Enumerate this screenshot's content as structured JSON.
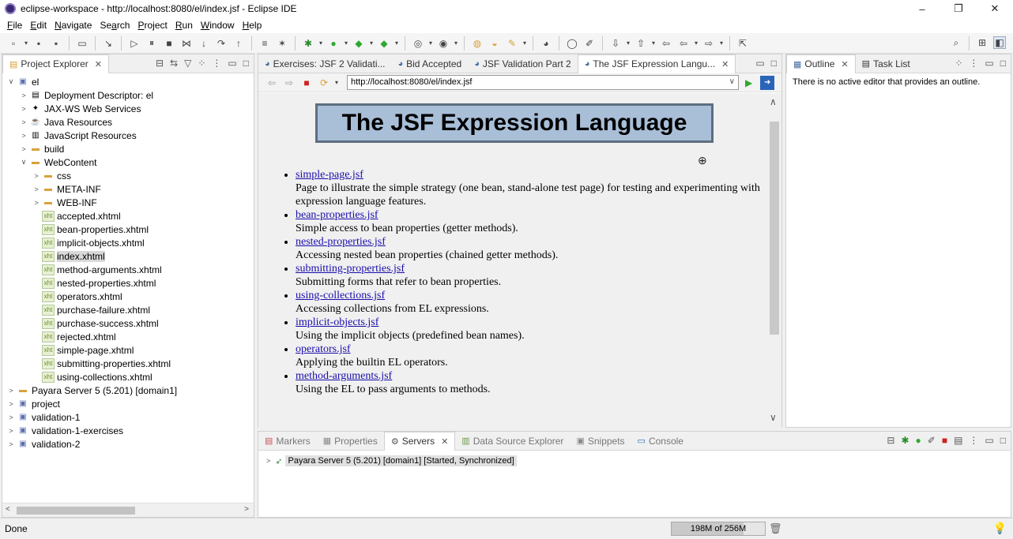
{
  "window": {
    "title": "eclipse-workspace - http://localhost:8080/el/index.jsf - Eclipse IDE",
    "controls": [
      "–",
      "❐",
      "✕"
    ]
  },
  "menubar": [
    {
      "label": "File",
      "u": "F",
      "rest": "ile"
    },
    {
      "label": "Edit",
      "u": "E",
      "rest": "dit"
    },
    {
      "label": "Navigate",
      "u": "N",
      "rest": "avigate"
    },
    {
      "label": "Search",
      "u": "",
      "rest": "Se",
      "u2": "a",
      "rest2": "rch"
    },
    {
      "label": "Project",
      "u": "P",
      "rest": "roject"
    },
    {
      "label": "Run",
      "u": "R",
      "rest": "un"
    },
    {
      "label": "Window",
      "u": "W",
      "rest": "indow"
    },
    {
      "label": "Help",
      "u": "H",
      "rest": "elp"
    }
  ],
  "explorer": {
    "tab_label": "Project Explorer",
    "tree": [
      {
        "label": "el",
        "level": 0,
        "tw": "∨",
        "icon": "proj"
      },
      {
        "label": "Deployment Descriptor: el",
        "level": 1,
        "tw": ">",
        "icon": "dd"
      },
      {
        "label": "JAX-WS Web Services",
        "level": 1,
        "tw": ">",
        "icon": "ws"
      },
      {
        "label": "Java Resources",
        "level": 1,
        "tw": ">",
        "icon": "java"
      },
      {
        "label": "JavaScript Resources",
        "level": 1,
        "tw": ">",
        "icon": "js"
      },
      {
        "label": "build",
        "level": 1,
        "tw": ">",
        "icon": "folder"
      },
      {
        "label": "WebContent",
        "level": 1,
        "tw": "∨",
        "icon": "folder"
      },
      {
        "label": "css",
        "level": 2,
        "tw": ">",
        "icon": "folder"
      },
      {
        "label": "META-INF",
        "level": 2,
        "tw": ">",
        "icon": "folder"
      },
      {
        "label": "WEB-INF",
        "level": 2,
        "tw": ">",
        "icon": "folder"
      },
      {
        "label": "accepted.xhtml",
        "level": 2,
        "tw": "",
        "icon": "xhtml"
      },
      {
        "label": "bean-properties.xhtml",
        "level": 2,
        "tw": "",
        "icon": "xhtml"
      },
      {
        "label": "implicit-objects.xhtml",
        "level": 2,
        "tw": "",
        "icon": "xhtml"
      },
      {
        "label": "index.xhtml",
        "level": 2,
        "tw": "",
        "icon": "xhtml",
        "selected": true
      },
      {
        "label": "method-arguments.xhtml",
        "level": 2,
        "tw": "",
        "icon": "xhtml"
      },
      {
        "label": "nested-properties.xhtml",
        "level": 2,
        "tw": "",
        "icon": "xhtml"
      },
      {
        "label": "operators.xhtml",
        "level": 2,
        "tw": "",
        "icon": "xhtml"
      },
      {
        "label": "purchase-failure.xhtml",
        "level": 2,
        "tw": "",
        "icon": "xhtml"
      },
      {
        "label": "purchase-success.xhtml",
        "level": 2,
        "tw": "",
        "icon": "xhtml"
      },
      {
        "label": "rejected.xhtml",
        "level": 2,
        "tw": "",
        "icon": "xhtml"
      },
      {
        "label": "simple-page.xhtml",
        "level": 2,
        "tw": "",
        "icon": "xhtml"
      },
      {
        "label": "submitting-properties.xhtml",
        "level": 2,
        "tw": "",
        "icon": "xhtml"
      },
      {
        "label": "using-collections.xhtml",
        "level": 2,
        "tw": "",
        "icon": "xhtml"
      },
      {
        "label": "Payara Server 5 (5.201) [domain1]",
        "level": 0,
        "tw": ">",
        "icon": "folder"
      },
      {
        "label": "project",
        "level": 0,
        "tw": ">",
        "icon": "proj"
      },
      {
        "label": "validation-1",
        "level": 0,
        "tw": ">",
        "icon": "proj"
      },
      {
        "label": "validation-1-exercises",
        "level": 0,
        "tw": ">",
        "icon": "proj"
      },
      {
        "label": "validation-2",
        "level": 0,
        "tw": ">",
        "icon": "proj"
      }
    ]
  },
  "editor": {
    "tabs": [
      {
        "label": "Exercises: JSF 2 Validati...",
        "active": false
      },
      {
        "label": "Bid Accepted",
        "active": false
      },
      {
        "label": "JSF Validation Part 2",
        "active": false
      },
      {
        "label": "The JSF Expression Langu...",
        "active": true
      }
    ],
    "url": "http://localhost:8080/el/index.jsf",
    "page": {
      "heading": "The JSF Expression Language",
      "items": [
        {
          "link": "simple-page.jsf",
          "desc": "Page to illustrate the simple strategy (one bean, stand-alone test page) for testing and experimenting with expression language features."
        },
        {
          "link": "bean-properties.jsf",
          "desc": "Simple access to bean properties (getter methods)."
        },
        {
          "link": "nested-properties.jsf",
          "desc": "Accessing nested bean properties (chained getter methods)."
        },
        {
          "link": "submitting-properties.jsf",
          "desc": "Submitting forms that refer to bean properties."
        },
        {
          "link": "using-collections.jsf",
          "desc": "Accessing collections from EL expressions."
        },
        {
          "link": "implicit-objects.jsf",
          "desc": "Using the implicit objects (predefined bean names)."
        },
        {
          "link": "operators.jsf",
          "desc": "Applying the builtin EL operators."
        },
        {
          "link": "method-arguments.jsf",
          "desc": "Using the EL to pass arguments to methods."
        }
      ]
    }
  },
  "outline": {
    "tabs": [
      "Outline",
      "Task List"
    ],
    "message": "There is no active editor that provides an outline."
  },
  "bottom": {
    "tabs": [
      "Markers",
      "Properties",
      "Servers",
      "Data Source Explorer",
      "Snippets",
      "Console"
    ],
    "active": "Servers",
    "server_row": "Payara Server 5 (5.201) [domain1]  [Started, Synchronized]"
  },
  "status": {
    "text": "Done",
    "heap": "198M of 256M"
  }
}
